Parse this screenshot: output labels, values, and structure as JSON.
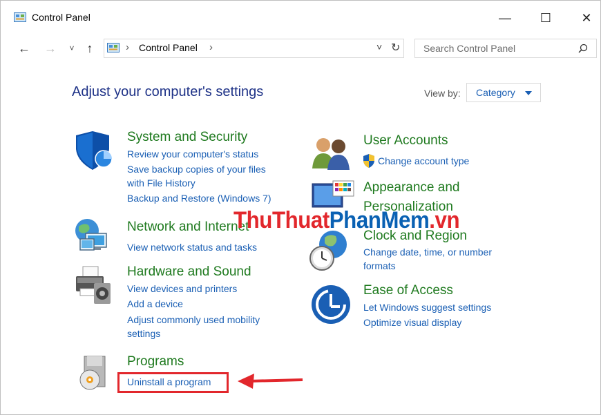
{
  "window": {
    "title": "Control Panel",
    "minimize_glyph": "—",
    "maximize_glyph": "☐",
    "close_glyph": "✕"
  },
  "nav": {
    "back_glyph": "←",
    "forward_glyph": "→",
    "recent_glyph": "˅",
    "up_glyph": "↑",
    "breadcrumb": "Control Panel",
    "separator": "›",
    "dropdown_glyph": "˅",
    "refresh_glyph": "↻",
    "search_placeholder": "Search Control Panel"
  },
  "main": {
    "heading": "Adjust your computer's settings",
    "view_by_label": "View by:",
    "view_by_value": "Category"
  },
  "categories": {
    "system": {
      "title": "System and Security",
      "links": [
        "Review your computer's status",
        "Save backup copies of your files",
        "with File History",
        "Backup and Restore (Windows 7)"
      ]
    },
    "network": {
      "title": "Network and Internet",
      "links": [
        "View network status and tasks"
      ]
    },
    "hardware": {
      "title": "Hardware and Sound",
      "links": [
        "View devices and printers",
        "Add a device",
        "Adjust commonly used mobility",
        "settings"
      ]
    },
    "programs": {
      "title": "Programs",
      "links": [
        "Uninstall a program"
      ]
    },
    "users": {
      "title": "User Accounts",
      "links": [
        "Change account type"
      ]
    },
    "appearance": {
      "title_line1": "Appearance and",
      "title_line2": "Personalization"
    },
    "clock": {
      "title": "Clock and Region",
      "links": [
        "Change date, time, or number",
        "formats"
      ]
    },
    "ease": {
      "title": "Ease of Access",
      "links": [
        "Let Windows suggest settings",
        "Optimize visual display"
      ]
    }
  },
  "watermark": {
    "part1": "ThuThuat",
    "part2": "PhanMem",
    "part3": ".vn"
  },
  "colors": {
    "heading": "#1e3287",
    "category_title": "#1f7a1f",
    "link": "#1a5fb4",
    "annotation_red": "#e2272c"
  }
}
